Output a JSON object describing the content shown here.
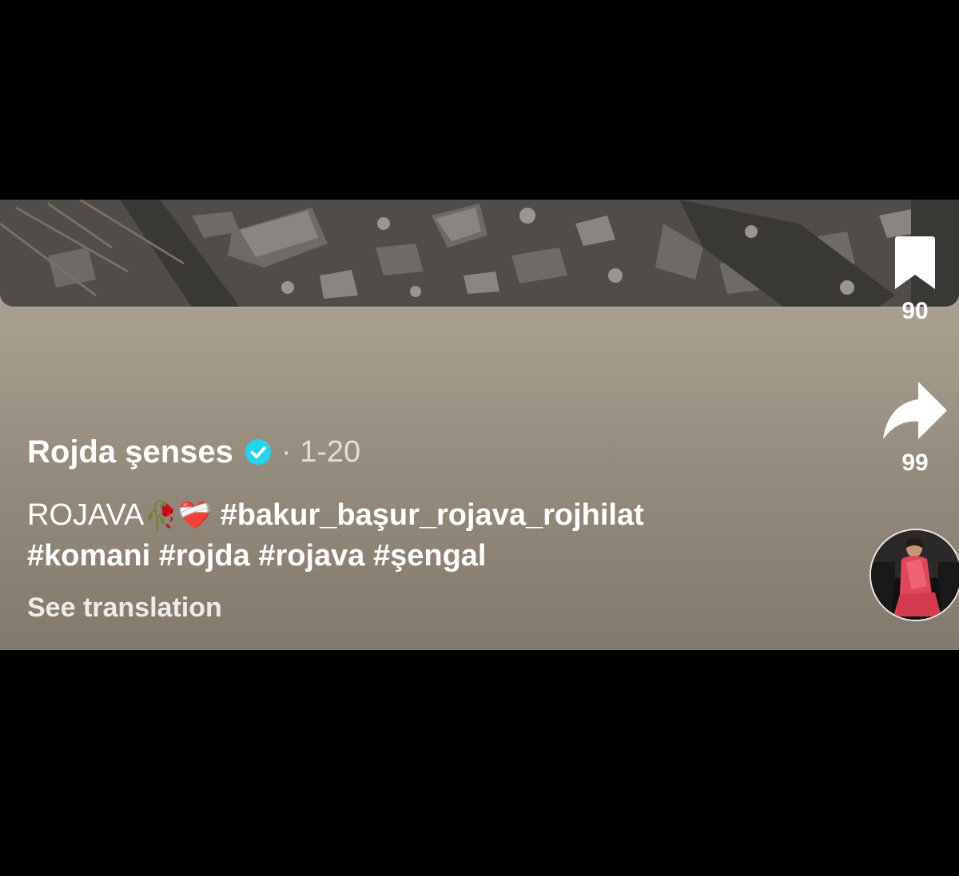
{
  "post": {
    "username": "Rojda şenses",
    "verified_icon": "verified-check-icon",
    "separator": "·",
    "date": "1-20",
    "caption": {
      "text": "ROJAVA",
      "emojis": "🥀❤️‍🩹",
      "hashtags_line1": "#bakur_başur_rojava_rojhilat",
      "hashtags_line2": "#komani #rojda #rojava #şengal"
    },
    "see_translation": "See translation"
  },
  "actions": {
    "bookmark": {
      "icon": "bookmark-icon",
      "count": "90"
    },
    "share": {
      "icon": "share-arrow-icon",
      "count": "99"
    }
  },
  "avatar": {
    "icon": "profile-avatar"
  },
  "colors": {
    "verified_blue": "#20d5ec",
    "panel": "#a59b8b",
    "background": "#000000"
  }
}
